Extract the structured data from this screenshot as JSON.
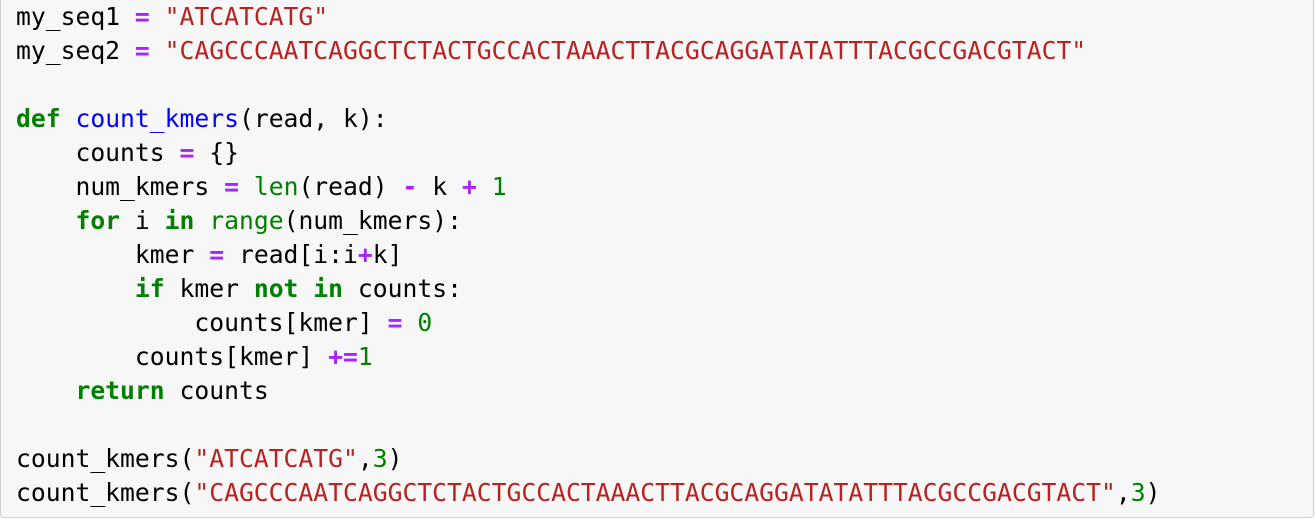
{
  "code_cell": {
    "lines": [
      [
        [
          "default",
          "my_seq1 "
        ],
        [
          "operator",
          "="
        ],
        [
          "default",
          " "
        ],
        [
          "string",
          "\"ATCATCATG\""
        ]
      ],
      [
        [
          "default",
          "my_seq2 "
        ],
        [
          "operator",
          "="
        ],
        [
          "default",
          " "
        ],
        [
          "string",
          "\"CAGCCCAATCAGGCTCTACTGCCACTAAACTTACGCAGGATATATTTACGCCGACGTACT\""
        ]
      ],
      [],
      [
        [
          "keyword",
          "def"
        ],
        [
          "default",
          " "
        ],
        [
          "def",
          "count_kmers"
        ],
        [
          "default",
          "(read, k):"
        ]
      ],
      [
        [
          "default",
          "    counts "
        ],
        [
          "operator",
          "="
        ],
        [
          "default",
          " {}"
        ]
      ],
      [
        [
          "default",
          "    num_kmers "
        ],
        [
          "operator",
          "="
        ],
        [
          "default",
          " "
        ],
        [
          "builtin",
          "len"
        ],
        [
          "default",
          "(read) "
        ],
        [
          "operator",
          "-"
        ],
        [
          "default",
          " k "
        ],
        [
          "operator",
          "+"
        ],
        [
          "default",
          " "
        ],
        [
          "number",
          "1"
        ]
      ],
      [
        [
          "default",
          "    "
        ],
        [
          "keyword",
          "for"
        ],
        [
          "default",
          " i "
        ],
        [
          "keyword",
          "in"
        ],
        [
          "default",
          " "
        ],
        [
          "builtin",
          "range"
        ],
        [
          "default",
          "(num_kmers):"
        ]
      ],
      [
        [
          "default",
          "        kmer "
        ],
        [
          "operator",
          "="
        ],
        [
          "default",
          " read[i:i"
        ],
        [
          "operator",
          "+"
        ],
        [
          "default",
          "k]"
        ]
      ],
      [
        [
          "default",
          "        "
        ],
        [
          "keyword",
          "if"
        ],
        [
          "default",
          " kmer "
        ],
        [
          "keyword",
          "not"
        ],
        [
          "default",
          " "
        ],
        [
          "keyword",
          "in"
        ],
        [
          "default",
          " counts:"
        ]
      ],
      [
        [
          "default",
          "            counts[kmer] "
        ],
        [
          "operator",
          "="
        ],
        [
          "default",
          " "
        ],
        [
          "number",
          "0"
        ]
      ],
      [
        [
          "default",
          "        counts[kmer] "
        ],
        [
          "operator",
          "+="
        ],
        [
          "number",
          "1"
        ]
      ],
      [
        [
          "default",
          "    "
        ],
        [
          "keyword",
          "return"
        ],
        [
          "default",
          " counts"
        ]
      ],
      [],
      [
        [
          "default",
          "count_kmers("
        ],
        [
          "string",
          "\"ATCATCATG\""
        ],
        [
          "default",
          ","
        ],
        [
          "number",
          "3"
        ],
        [
          "default",
          ")"
        ]
      ],
      [
        [
          "default",
          "count_kmers("
        ],
        [
          "string",
          "\"CAGCCCAATCAGGCTCTACTGCCACTAAACTTACGCAGGATATATTTACGCCGACGTACT\""
        ],
        [
          "default",
          ","
        ],
        [
          "number",
          "3"
        ],
        [
          "default",
          ")"
        ]
      ]
    ]
  },
  "colors": {
    "keyword": "#008000",
    "operator": "#aa22ff",
    "string": "#ba2121",
    "number": "#008000",
    "builtin": "#008000",
    "def": "#0000ff",
    "background": "#f7f7f7",
    "border": "#cfcfcf"
  }
}
